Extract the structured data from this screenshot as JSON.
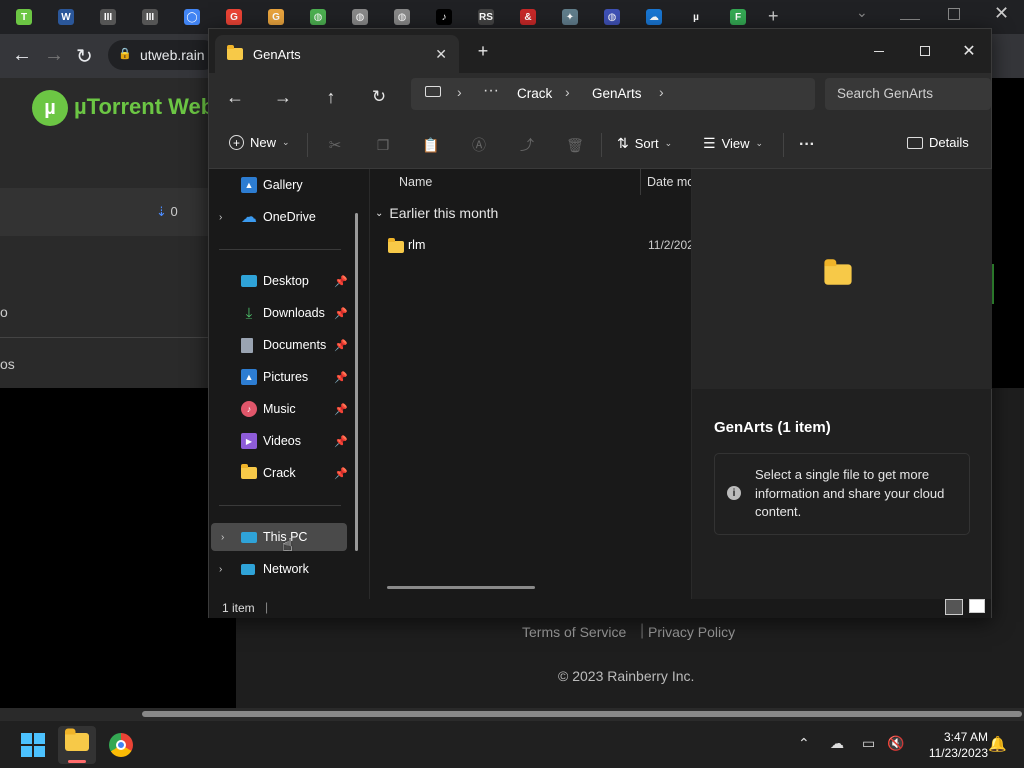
{
  "chrome": {
    "tabs": [
      {
        "icon": "utorrent-icon",
        "color": "#6cc644",
        "label": "T"
      },
      {
        "icon": "word-icon",
        "color": "#2b579a",
        "label": "W"
      },
      {
        "icon": "bank-icon",
        "color": "#555",
        "label": "III"
      },
      {
        "icon": "bank-icon",
        "color": "#555",
        "label": "III"
      },
      {
        "icon": "chrome-icon",
        "color": "#4285f4",
        "label": "◯"
      },
      {
        "icon": "google-icon",
        "color": "#ea4335",
        "label": "G"
      },
      {
        "icon": "g-icon",
        "color": "#e8a33d",
        "label": "G"
      },
      {
        "icon": "globe-icon",
        "color": "#4caf50",
        "label": "◍"
      },
      {
        "icon": "globe-icon",
        "color": "#888",
        "label": "◍"
      },
      {
        "icon": "globe-icon",
        "color": "#888",
        "label": "◍"
      },
      {
        "icon": "tiktok-icon",
        "color": "#000",
        "label": "♪"
      },
      {
        "icon": "rs-icon",
        "color": "#444",
        "label": "RS"
      },
      {
        "icon": "red-icon",
        "color": "#c62828",
        "label": "&"
      },
      {
        "icon": "bird-icon",
        "color": "#607d8b",
        "label": "✦"
      },
      {
        "icon": "globe-icon",
        "color": "#3f51b5",
        "label": "◍"
      },
      {
        "icon": "cloud-icon",
        "color": "#1976d2",
        "label": "☁"
      },
      {
        "icon": "mu-icon",
        "color": "#202124",
        "label": "µ"
      },
      {
        "icon": "flag-icon",
        "color": "#34a853",
        "label": "F"
      }
    ],
    "address_text": "utweb.rain",
    "new_tab_symbol": "+",
    "caret_symbol": "⌄"
  },
  "utorrent": {
    "logo_text": "µTorrent Web",
    "down_count": "0",
    "row1": "o",
    "row2": "os",
    "footer_terms": "Terms of Service",
    "footer_privacy": "Privacy Policy",
    "copyright": "© 2023 Rainberry Inc."
  },
  "explorer": {
    "tab_title": "GenArts",
    "breadcrumb": [
      "Crack",
      "GenArts"
    ],
    "search_placeholder": "Search GenArts",
    "cmd": {
      "new": "New",
      "sort": "Sort",
      "view": "View",
      "details": "Details"
    },
    "nav": {
      "gallery": "Gallery",
      "onedrive": "OneDrive",
      "desktop": "Desktop",
      "downloads": "Downloads",
      "documents": "Documents",
      "pictures": "Pictures",
      "music": "Music",
      "videos": "Videos",
      "crack": "Crack",
      "thispc": "This PC",
      "network": "Network"
    },
    "columns": {
      "name": "Name",
      "date": "Date mo"
    },
    "group_label": "Earlier this month",
    "files": [
      {
        "name": "rlm",
        "date": "11/2/202"
      }
    ],
    "details_pane": {
      "title": "GenArts (1 item)",
      "info": "Select a single file to get more information and share your cloud content."
    },
    "status": "1 item"
  },
  "taskbar": {
    "time": "3:47 AM",
    "date": "11/23/2023"
  }
}
